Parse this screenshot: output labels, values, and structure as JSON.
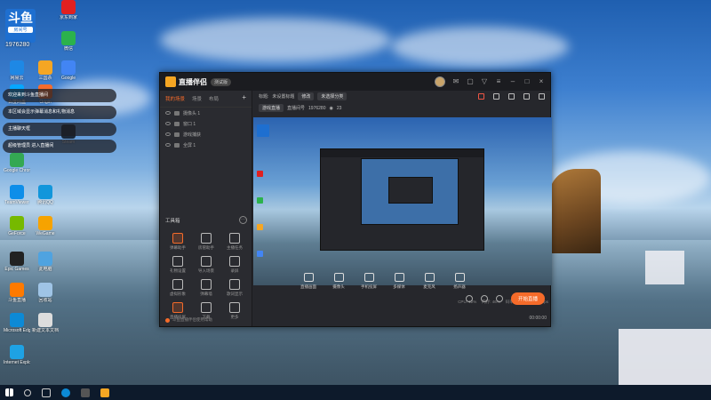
{
  "desktop": {
    "badge": {
      "big": "斗鱼",
      "small": "房间号"
    },
    "room_number": "1976280",
    "icons": [
      {
        "label": "京东到家",
        "color": "#e02020"
      },
      {
        "label": "微信",
        "color": "#2bb24c"
      },
      {
        "label": "网易云",
        "color": "#1e88e5"
      },
      {
        "label": "三国杀",
        "color": "#f5a623"
      },
      {
        "label": "Google",
        "color": "#4285f4"
      },
      {
        "label": "百度网盘",
        "color": "#06a7ff"
      },
      {
        "label": "Origin",
        "color": "#f56c2d"
      },
      {
        "label": "Steam",
        "color": "#1b2838"
      },
      {
        "label": "Google Chrome",
        "color": "#34a853"
      },
      {
        "label": "TeamViewer",
        "color": "#0e8ee9"
      },
      {
        "label": "腾讯QQ",
        "color": "#1296db"
      },
      {
        "label": "GeForce",
        "color": "#76b900"
      },
      {
        "label": "WeGame",
        "color": "#f6a300"
      },
      {
        "label": "Epic Games",
        "color": "#222"
      },
      {
        "label": "此电脑",
        "color": "#4fa3e0"
      },
      {
        "label": "斗鱼直播",
        "color": "#ff7a00"
      },
      {
        "label": "回收站",
        "color": "#9fc4e6"
      },
      {
        "label": "Microsoft Edge",
        "color": "#0c8ad6"
      },
      {
        "label": "新建文本文档",
        "color": "#ddd"
      },
      {
        "label": "Internet Explorer",
        "color": "#1ea2e4"
      }
    ],
    "popups": [
      "欢迎来到斗鱼直播间",
      "本区域会显示弹幕消息和礼物消息",
      "主播聊天框",
      "超级管理员 进入直播间"
    ]
  },
  "app": {
    "title": "直播伴侣",
    "version": "测试版",
    "left_tabs": [
      "我的场景",
      "场景",
      "布局"
    ],
    "plus": "+",
    "scenes": [
      "摄像头 1",
      "窗口 1",
      "游戏捕获",
      "全屏 1"
    ],
    "toolbox_title": "工具箱",
    "toolbox_more": "···",
    "tools": [
      {
        "label": "弹幕助手",
        "hot": true
      },
      {
        "label": "房管助手",
        "hot": false
      },
      {
        "label": "主播任务",
        "hot": false
      },
      {
        "label": "礼物设置",
        "hot": false
      },
      {
        "label": "导入场景",
        "hot": false
      },
      {
        "label": "录屏",
        "hot": false
      },
      {
        "label": "虚拟形象",
        "hot": false
      },
      {
        "label": "弹幕墙",
        "hot": false
      },
      {
        "label": "歌词显示",
        "hot": false
      },
      {
        "label": "直播投屏",
        "hot": true
      },
      {
        "label": "下载",
        "hot": false
      },
      {
        "label": "更多",
        "hot": false
      }
    ],
    "footer_text": "斗鱼直播伴侣使用帮助",
    "info": {
      "label_title": "标题:",
      "title_value": "未设置标题",
      "edit": "修改",
      "category": "未选择分类",
      "label_type": "直播类型:",
      "type_value": "游戏直播",
      "room_label": "直播间号",
      "room_value": "1976280",
      "viewers": "23"
    },
    "controls": [
      "直播画面",
      "摄像头",
      "手机投屏",
      "多媒体",
      "麦克风",
      "扬声器"
    ],
    "status": [
      "CPU: 12%",
      "内存: 46%",
      "码率: 0kb/s",
      "帧率: 0fps"
    ],
    "start_label": "开始直播",
    "timer": "00:00:00"
  }
}
